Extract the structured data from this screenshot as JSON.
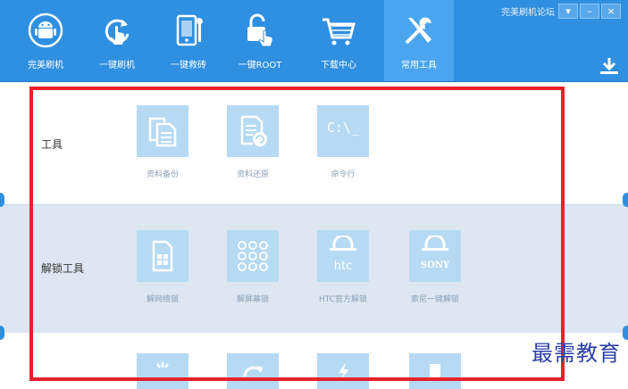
{
  "window": {
    "title": "完美刷机论坛",
    "buttons": [
      "▾",
      "–",
      "×"
    ]
  },
  "nav": [
    {
      "label": "完美刷机",
      "icon": "android-icon",
      "active": false
    },
    {
      "label": "一键刷机",
      "icon": "refresh-hand-icon",
      "active": false
    },
    {
      "label": "一键救砖",
      "icon": "phone-wrench-icon",
      "active": false
    },
    {
      "label": "一键ROOT",
      "icon": "unlock-hand-icon",
      "active": false
    },
    {
      "label": "下载中心",
      "icon": "cart-icon",
      "active": false
    },
    {
      "label": "常用工具",
      "icon": "tools-icon",
      "active": true
    }
  ],
  "sections": [
    {
      "title": "工具",
      "tools": [
        {
          "label": "资料备份",
          "icon": "backup-icon"
        },
        {
          "label": "资料还原",
          "icon": "restore-icon"
        },
        {
          "label": "命令行",
          "icon": "command-line-icon",
          "glyph": "C:\\_"
        }
      ]
    },
    {
      "title": "解锁工具",
      "tools": [
        {
          "label": "解网络锁",
          "icon": "sim-card-icon"
        },
        {
          "label": "解屏幕锁",
          "icon": "pattern-lock-icon"
        },
        {
          "label": "HTC官方解锁",
          "icon": "htc-lock-icon",
          "glyph": "htc"
        },
        {
          "label": "索尼一键解锁",
          "icon": "sony-lock-icon",
          "glyph": "SONY"
        }
      ]
    }
  ],
  "watermark": "最需教育",
  "colors": {
    "accent": "#2f8fe0",
    "active": "#4aa5ee",
    "tile": "#b6daf3",
    "highlight": "#e8212b"
  }
}
